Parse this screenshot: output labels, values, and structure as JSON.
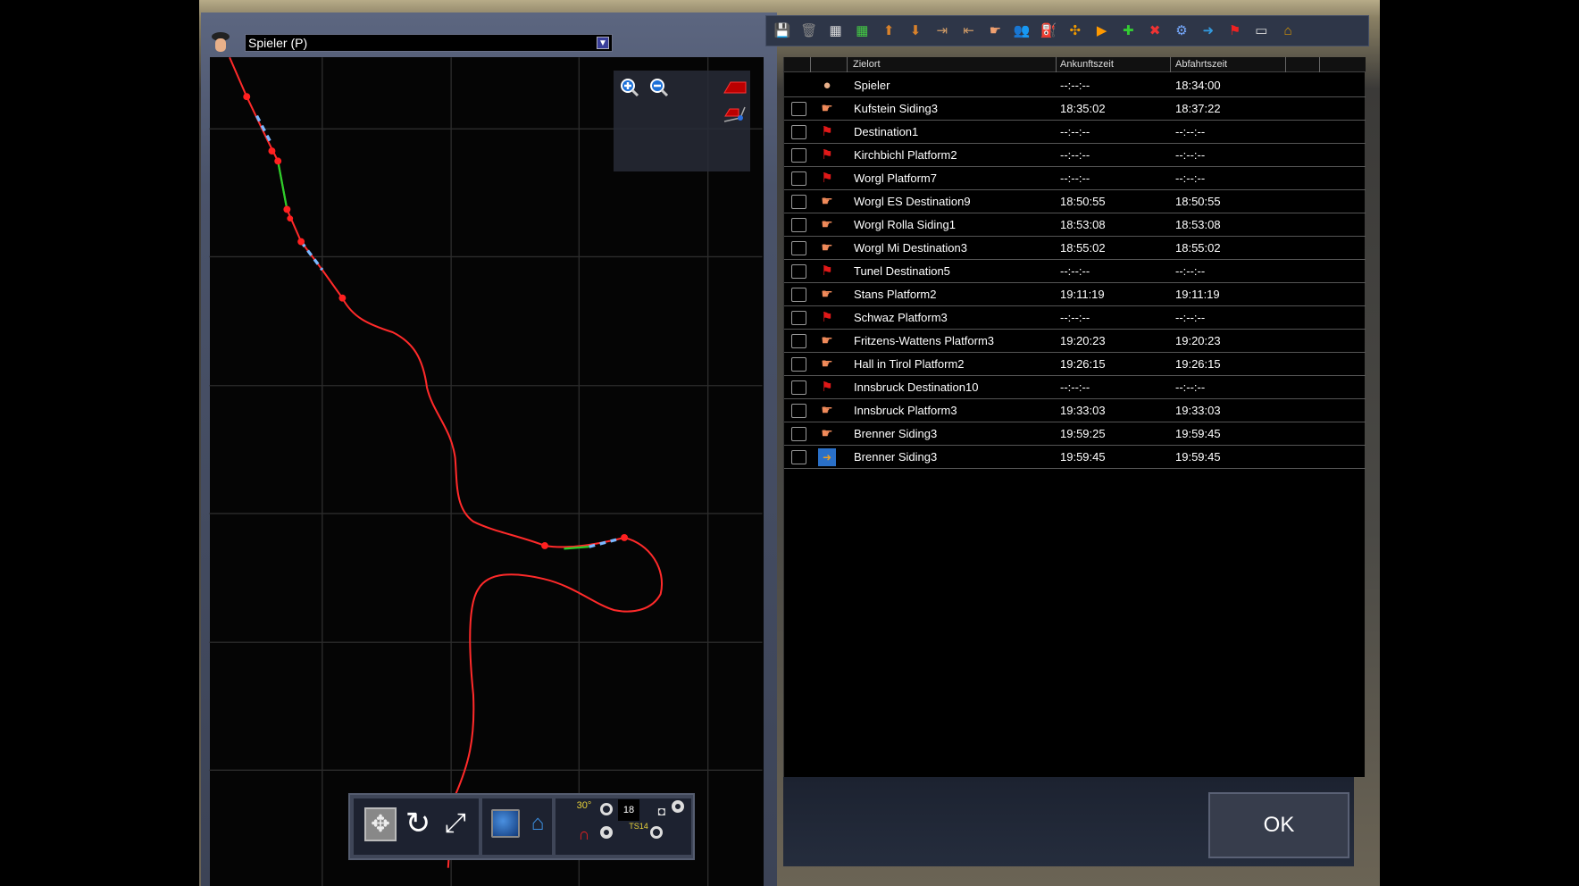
{
  "driver_select": {
    "value": "Spieler (P)"
  },
  "map_overlay": {
    "icons": [
      "zoom-in-icon",
      "zoom-out-icon",
      "track-piece-icon",
      "track-node-icon"
    ]
  },
  "toolbar": {
    "icons": [
      "save-icon",
      "trash-icon",
      "grid-empty-icon",
      "grid-green-icon",
      "move-up-icon",
      "move-down-icon",
      "insert-after-icon",
      "insert-before-icon",
      "pointing-hand-icon",
      "passengers-icon",
      "refuel-icon",
      "couple-icon",
      "add-stop-icon",
      "add-after-icon",
      "delete-instruction-icon",
      "settings-icon",
      "exit-icon",
      "flag-icon",
      "consist-icon",
      "consist-roof-icon"
    ]
  },
  "table": {
    "headers": {
      "destination": "Zielort",
      "arrival": "Ankunftszeit",
      "departure": "Abfahrtszeit"
    },
    "rows": [
      {
        "icon": "player",
        "name": "Spieler",
        "arrival": "--:--:--",
        "departure": "18:34:00",
        "checkbox": false
      },
      {
        "icon": "hand",
        "name": "Kufstein Siding3",
        "arrival": "18:35:02",
        "departure": "18:37:22",
        "checkbox": true
      },
      {
        "icon": "flag",
        "name": "Destination1",
        "arrival": "--:--:--",
        "departure": "--:--:--",
        "checkbox": true
      },
      {
        "icon": "flag",
        "name": "Kirchbichl Platform2",
        "arrival": "--:--:--",
        "departure": "--:--:--",
        "checkbox": true
      },
      {
        "icon": "flag",
        "name": "Worgl Platform7",
        "arrival": "--:--:--",
        "departure": "--:--:--",
        "checkbox": true
      },
      {
        "icon": "hand",
        "name": "Worgl ES Destination9",
        "arrival": "18:50:55",
        "departure": "18:50:55",
        "checkbox": true
      },
      {
        "icon": "hand",
        "name": "Worgl Rolla Siding1",
        "arrival": "18:53:08",
        "departure": "18:53:08",
        "checkbox": true
      },
      {
        "icon": "hand",
        "name": "Worgl Mi Destination3",
        "arrival": "18:55:02",
        "departure": "18:55:02",
        "checkbox": true
      },
      {
        "icon": "flag",
        "name": "Tunel Destination5",
        "arrival": "--:--:--",
        "departure": "--:--:--",
        "checkbox": true
      },
      {
        "icon": "hand",
        "name": "Stans Platform2",
        "arrival": "19:11:19",
        "departure": "19:11:19",
        "checkbox": true
      },
      {
        "icon": "flag",
        "name": "Schwaz Platform3",
        "arrival": "--:--:--",
        "departure": "--:--:--",
        "checkbox": true
      },
      {
        "icon": "hand",
        "name": "Fritzens-Wattens Platform3",
        "arrival": "19:20:23",
        "departure": "19:20:23",
        "checkbox": true
      },
      {
        "icon": "hand",
        "name": "Hall in Tirol Platform2",
        "arrival": "19:26:15",
        "departure": "19:26:15",
        "checkbox": true
      },
      {
        "icon": "flag",
        "name": "Innsbruck Destination10",
        "arrival": "--:--:--",
        "departure": "--:--:--",
        "checkbox": true
      },
      {
        "icon": "hand",
        "name": "Innsbruck Platform3",
        "arrival": "19:33:03",
        "departure": "19:33:03",
        "checkbox": true
      },
      {
        "icon": "hand",
        "name": "Brenner Siding3",
        "arrival": "19:59:25",
        "departure": "19:59:45",
        "checkbox": true
      },
      {
        "icon": "end",
        "name": "Brenner Siding3",
        "arrival": "19:59:45",
        "departure": "19:59:45",
        "checkbox": true
      }
    ]
  },
  "ok_button": "OK",
  "map_tools": {
    "angle_label": "30°",
    "ts_label": "TS14",
    "number_value": "18"
  },
  "colors": {
    "track": "#ff2a2a",
    "hand": "#f08a5a",
    "flag": "#e01818",
    "panel": "#3c4356"
  }
}
